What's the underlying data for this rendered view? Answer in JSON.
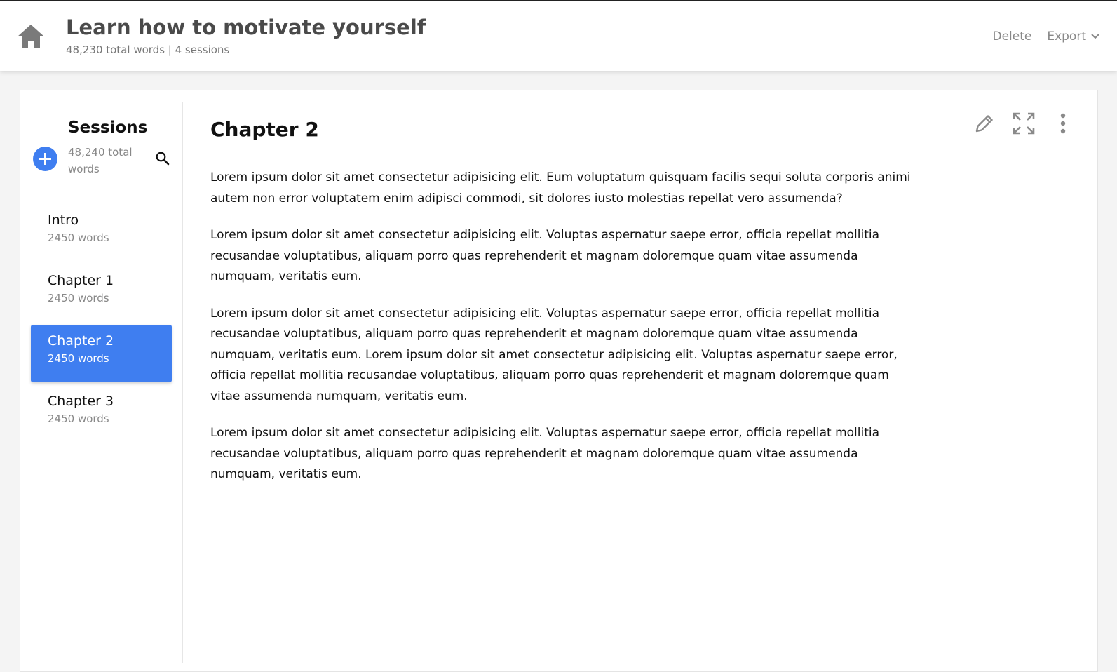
{
  "header": {
    "title": "Learn how to motivate yourself",
    "stats": "48,230 total words | 4 sessions",
    "delete_label": "Delete",
    "export_label": "Export",
    "icons": {
      "home": "home-icon",
      "export_menu": "chevron-down-icon"
    }
  },
  "sidebar": {
    "title": "Sessions",
    "total_words": "48,240 total words",
    "icons": {
      "add": "plus-icon",
      "search": "search-icon"
    },
    "accent_color": "#3f7ef0",
    "sessions": [
      {
        "name": "Intro",
        "words": "2450 words",
        "active": false
      },
      {
        "name": "Chapter 1",
        "words": "2450 words",
        "active": false
      },
      {
        "name": "Chapter 2",
        "words": "2450 words",
        "active": true
      },
      {
        "name": "Chapter 3",
        "words": "2450 words",
        "active": false
      }
    ]
  },
  "content": {
    "title": "Chapter 2",
    "tools": [
      "pencil-icon",
      "expand-icon",
      "more-vertical-icon"
    ],
    "paragraphs": [
      "Lorem ipsum dolor sit amet consectetur adipisicing elit. Eum voluptatum quisquam facilis sequi soluta corporis animi autem non error voluptatem enim adipisci commodi, sit dolores iusto molestias repellat vero assumenda?",
      "Lorem ipsum dolor sit amet consectetur adipisicing elit. Voluptas aspernatur saepe error, officia repellat mollitia recusandae voluptatibus, aliquam porro quas reprehenderit et magnam doloremque quam vitae assumenda numquam, veritatis eum.",
      "Lorem ipsum dolor sit amet consectetur adipisicing elit. Voluptas aspernatur saepe error, officia repellat mollitia recusandae voluptatibus, aliquam porro quas reprehenderit et magnam doloremque quam vitae assumenda numquam, veritatis eum. Lorem ipsum dolor sit amet consectetur adipisicing elit. Voluptas aspernatur saepe error, officia repellat mollitia recusandae voluptatibus, aliquam porro quas reprehenderit et magnam doloremque quam vitae assumenda numquam, veritatis eum.",
      "Lorem ipsum dolor sit amet consectetur adipisicing elit. Voluptas aspernatur saepe error, officia repellat mollitia recusandae voluptatibus, aliquam porro quas reprehenderit et magnam doloremque quam vitae assumenda numquam, veritatis eum."
    ]
  }
}
